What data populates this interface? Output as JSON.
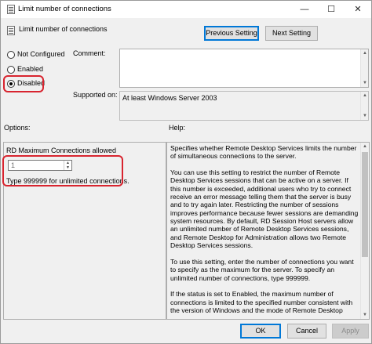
{
  "window": {
    "title": "Limit number of connections",
    "minimize_glyph": "—",
    "maximize_glyph": "☐",
    "close_glyph": "✕"
  },
  "header": {
    "title": "Limit number of connections",
    "previous_setting": "Previous Setting",
    "next_setting": "Next Setting"
  },
  "state": {
    "options": [
      {
        "label": "Not Configured",
        "checked": false
      },
      {
        "label": "Enabled",
        "checked": false
      },
      {
        "label": "Disabled",
        "checked": true
      }
    ]
  },
  "comment": {
    "label": "Comment:",
    "value": ""
  },
  "supported": {
    "label": "Supported on:",
    "value": "At least Windows Server 2003"
  },
  "options_panel": {
    "heading": "Options:",
    "field_label": "RD Maximum Connections allowed",
    "field_value": "1",
    "hint": "Type 999999 for unlimited connections."
  },
  "help_panel": {
    "heading": "Help:",
    "paragraphs": [
      "Specifies whether Remote Desktop Services limits the number of simultaneous connections to the server.",
      "You can use this setting to restrict the number of Remote Desktop Services sessions that can be active on a server. If this number is exceeded, additional users who try to connect receive an error message telling them that the server is busy and to try again later. Restricting the number of sessions improves performance because fewer sessions are demanding system resources. By default, RD Session Host servers allow an unlimited number of Remote Desktop Services sessions, and Remote Desktop for Administration allows two Remote Desktop Services sessions.",
      "To use this setting, enter the number of connections you want to specify as the maximum for the server. To specify an unlimited number of connections, type 999999.",
      "If the status is set to Enabled, the maximum number of connections is limited to the specified number consistent with the version of Windows and the mode of Remote Desktop"
    ]
  },
  "footer": {
    "ok": "OK",
    "cancel": "Cancel",
    "apply": "Apply"
  },
  "colors": {
    "highlight_red": "#d8242f",
    "focus_blue": "#0078d7"
  }
}
